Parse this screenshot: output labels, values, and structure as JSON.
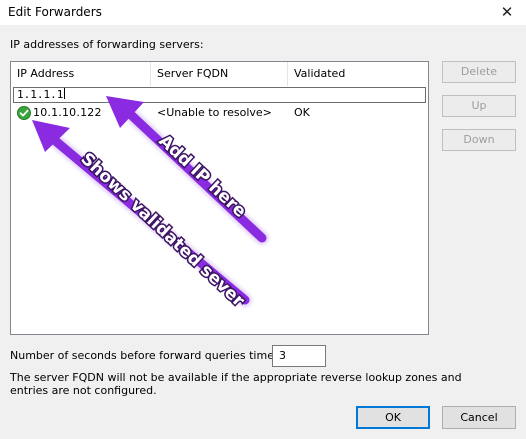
{
  "window": {
    "title": "Edit Forwarders",
    "close_glyph": "✕"
  },
  "section_label": "IP addresses of forwarding servers:",
  "table": {
    "columns": [
      "IP Address",
      "Server FQDN",
      "Validated"
    ],
    "edit_value": "1.1.1.1",
    "rows": [
      {
        "ip": "10.1.10.122",
        "fqdn": "<Unable to resolve>",
        "validated": "OK",
        "icon": "check-circle-icon"
      }
    ]
  },
  "buttons": {
    "delete": "Delete",
    "up": "Up",
    "down": "Down",
    "ok": "OK",
    "cancel": "Cancel"
  },
  "timeout": {
    "label": "Number of seconds before forward queries time out:",
    "value": "3"
  },
  "note": "The server FQDN will not be available if the appropriate reverse lookup zones and entries are not configured.",
  "annotations": {
    "add_ip": "Add IP here",
    "validated": "Shows validated sever",
    "arrow_color": "#8a2be2"
  },
  "colors": {
    "check": "#3aa53a",
    "focus_border": "#0078d7",
    "disabled_text": "#9d9d9d"
  }
}
